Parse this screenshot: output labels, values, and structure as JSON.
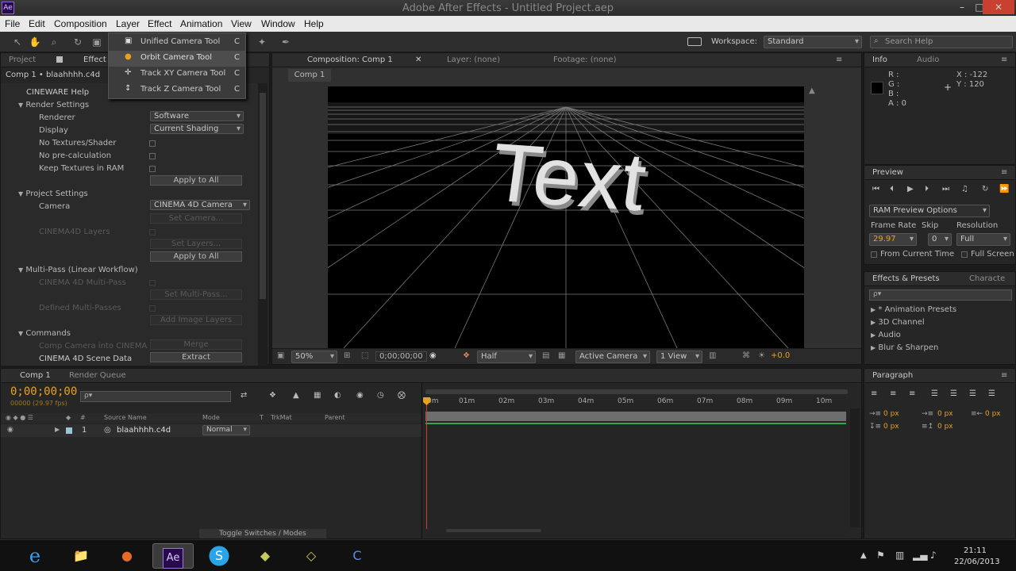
{
  "window": {
    "title": "Adobe After Effects - Untitled Project.aep",
    "min": "–",
    "max": "□",
    "close": "✕"
  },
  "app_badge": "Ae",
  "menus": [
    "File",
    "Edit",
    "Composition",
    "Layer",
    "Effect",
    "Animation",
    "View",
    "Window",
    "Help"
  ],
  "toolbar": {
    "workspace_label": "Workspace:",
    "workspace_value": "Standard",
    "search_placeholder": "Search Help"
  },
  "camera_menu": {
    "items": [
      {
        "label": "Unified Camera Tool",
        "key": "C"
      },
      {
        "label": "Orbit Camera Tool",
        "key": "C"
      },
      {
        "label": "Track XY Camera Tool",
        "key": "C"
      },
      {
        "label": "Track Z Camera Tool",
        "key": "C"
      }
    ]
  },
  "left_panel": {
    "tabs": [
      "Project",
      "Effect"
    ],
    "header": "Comp 1 • blaahhhh.c4d",
    "help": "CINEWARE Help",
    "render_settings": "Render Settings",
    "renderer_label": "Renderer",
    "renderer_value": "Software",
    "display_label": "Display",
    "display_value": "Current Shading",
    "no_textures": "No Textures/Shader",
    "no_precalc": "No pre-calculation",
    "keep_textures": "Keep Textures in RAM",
    "apply_all": "Apply to All",
    "project_settings": "Project Settings",
    "camera_label": "Camera",
    "camera_value": "CINEMA 4D Camera",
    "set_camera": "Set Camera...",
    "c4d_layers": "CINEMA4D Layers",
    "set_layers": "Set Layers...",
    "apply_all2": "Apply to All",
    "multipass": "Multi-Pass (Linear Workflow)",
    "c4d_multipass": "CINEMA 4D Multi-Pass",
    "set_multipass": "Set Multi-Pass...",
    "defined_multipasses": "Defined Multi-Passes",
    "add_image_layers": "Add Image Layers",
    "commands": "Commands",
    "comp_camera": "Comp Camera into CINEMA",
    "merge": "Merge",
    "scene_data": "CINEMA 4D Scene Data",
    "extract": "Extract"
  },
  "comp_panel": {
    "tab": "Composition: Comp 1",
    "layer": "Layer: (none)",
    "footage": "Footage: (none)",
    "subtab": "Comp 1",
    "viewer_text": "Text",
    "zoom": "50%",
    "timecode": "0;00;00;00",
    "resolution": "Half",
    "camera": "Active Camera",
    "views": "1 View",
    "exposure": "+0.0"
  },
  "info_panel": {
    "tabs": [
      "Info",
      "Audio"
    ],
    "r": "R :",
    "g": "G :",
    "b": "B :",
    "a": "A : 0",
    "x": "X : -122",
    "y": "Y : 120"
  },
  "preview_panel": {
    "tab": "Preview",
    "ram_options": "RAM Preview Options",
    "frame_rate_label": "Frame Rate",
    "skip_label": "Skip",
    "resolution_label": "Resolution",
    "frame_rate": "29.97",
    "skip": "0",
    "resolution": "Full",
    "from_current": "From Current Time",
    "full_screen": "Full Screen"
  },
  "effects_panel": {
    "tabs": [
      "Effects & Presets",
      "Characte"
    ],
    "search_placeholder": "ρ▾",
    "items": [
      "* Animation Presets",
      "3D Channel",
      "Audio",
      "Blur & Sharpen"
    ]
  },
  "timeline": {
    "tabs": [
      "Comp 1",
      "Render Queue"
    ],
    "timecode": "0;00;00;00",
    "fps": "00000 (29.97 fps)",
    "search_placeholder": "ρ▾",
    "col_source": "Source Name",
    "col_mode": "Mode",
    "col_t": "T",
    "col_trkmat": "TrkMat",
    "col_parent": "Parent",
    "col_hash": "#",
    "layer_num": "1",
    "layer_name": "blaahhhh.c4d",
    "layer_mode": "Normal",
    "ruler": [
      "0m",
      "01m",
      "02m",
      "03m",
      "04m",
      "05m",
      "06m",
      "07m",
      "08m",
      "09m",
      "10m"
    ],
    "toggle": "Toggle Switches / Modes"
  },
  "paragraph_panel": {
    "tab": "Paragraph",
    "values": [
      "0 px",
      "0 px",
      "0 px",
      "0 px",
      "0 px"
    ]
  },
  "taskbar": {
    "apps": [
      "e",
      "📁",
      "●",
      "Ae",
      "S",
      "◆",
      "◇",
      "C"
    ],
    "time": "21:11",
    "date": "22/06/2013"
  },
  "colors": {
    "accent": "#e8a11f",
    "green_bar": "#2fa84f",
    "playhead": "#d13a2a",
    "ae_purple": "#2a0a4e"
  }
}
